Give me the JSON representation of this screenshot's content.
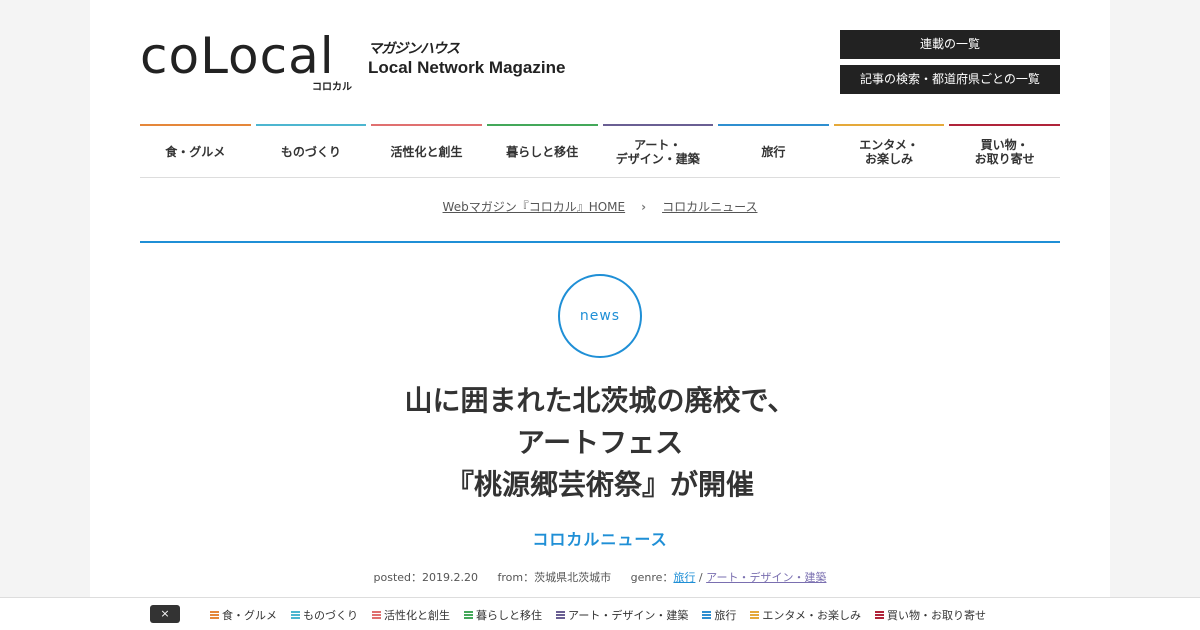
{
  "header": {
    "logo_text": "coLocal",
    "logo_sub": "コロカル",
    "publisher": "マガジンハウス",
    "tagline": "Local Network Magazine",
    "buttons": [
      "連載の一覧",
      "記事の検索・都道府県ごとの一覧"
    ]
  },
  "nav": [
    {
      "label": "食・グルメ",
      "color": "#e5873a"
    },
    {
      "label": "ものづくり",
      "color": "#4db6d0"
    },
    {
      "label": "活性化と創生",
      "color": "#e07070"
    },
    {
      "label": "暮らしと移住",
      "color": "#44a85a"
    },
    {
      "label": "アート・\nデザイン・建築",
      "color": "#6a5f93"
    },
    {
      "label": "旅行",
      "color": "#2f8fd0"
    },
    {
      "label": "エンタメ・\nお楽しみ",
      "color": "#e5a93a"
    },
    {
      "label": "買い物・\nお取り寄せ",
      "color": "#b0243a"
    }
  ],
  "breadcrumb": {
    "home": "Webマガジン『コロカル』HOME",
    "separator": "›",
    "current": "コロカルニュース"
  },
  "article": {
    "badge": "news",
    "title": "山に囲まれた北茨城の廃校で、\nアートフェス\n『桃源郷芸術祭』が開催",
    "series": "コロカルニュース",
    "posted_label": "posted：2019.2.20",
    "from_label": "from：茨城県北茨城市",
    "genre_label": "genre：",
    "genre_1": "旅行",
    "genre_sep": " / ",
    "genre_2": "アート・デザイン・建築"
  },
  "bottombar": {
    "close_label": "×",
    "categories": [
      {
        "label": "食・グルメ",
        "color": "#e5873a"
      },
      {
        "label": "ものづくり",
        "color": "#4db6d0"
      },
      {
        "label": "活性化と創生",
        "color": "#e07070"
      },
      {
        "label": "暮らしと移住",
        "color": "#44a85a"
      },
      {
        "label": "アート・デザイン・建築",
        "color": "#6a5f93"
      },
      {
        "label": "旅行",
        "color": "#2f8fd0"
      },
      {
        "label": "エンタメ・お楽しみ",
        "color": "#e5a93a"
      },
      {
        "label": "買い物・お取り寄せ",
        "color": "#b0243a"
      }
    ]
  }
}
